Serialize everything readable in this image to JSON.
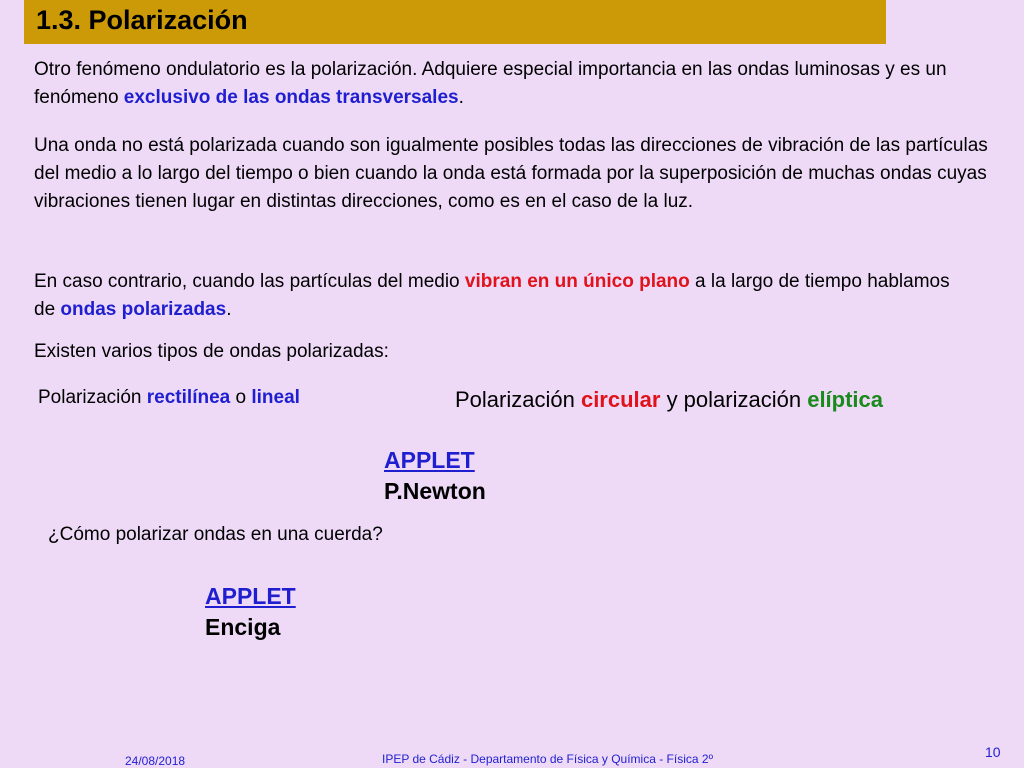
{
  "slide": {
    "title": "1.3.  Polarización",
    "para1": {
      "before": "Otro fenómeno ondulatorio es la polarización. Adquiere especial importancia en las ondas luminosas y es un fenómeno ",
      "highlight": "exclusivo  de las ondas transversales",
      "after": "."
    },
    "para2": "Una onda no está polarizada cuando son igualmente posibles todas las direcciones de vibración de las partículas del medio a lo largo del tiempo o bien cuando la onda está formada por la superposición de muchas ondas cuyas vibraciones tienen lugar en distintas direcciones, como es en el caso de la luz.",
    "para3": {
      "before": "En caso contrario, cuando las partículas del medio ",
      "highlight_red": "vibran en un único plano",
      "middle": " a la largo de tiempo hablamos de ",
      "highlight_blue": "ondas polarizadas",
      "after": "."
    },
    "para4": "Existen varios tipos de ondas polarizadas:",
    "type_linear": {
      "prefix": "Polarización ",
      "word1": "rectilínea",
      "connector": " o ",
      "word2": "lineal"
    },
    "type_circular": {
      "prefix": "Polarización ",
      "word1": "circular",
      "connector": " y polarización ",
      "word2": "elíptica"
    },
    "applet1": {
      "link": "APPLET",
      "source": "P.Newton"
    },
    "question": "¿Cómo polarizar ondas en una cuerda?",
    "applet2": {
      "link": "APPLET",
      "source": "Enciga"
    }
  },
  "footer": {
    "date": "24/08/2018",
    "center": "IPEP de Cádiz  -  Departamento de Física y Química  -  Física 2º",
    "page_number": "10"
  },
  "colors": {
    "background": "#eedaf7",
    "title_bar": "#cc9a06",
    "blue": "#1f1fd0",
    "red": "#e0121b",
    "green": "#1a8a1a"
  }
}
